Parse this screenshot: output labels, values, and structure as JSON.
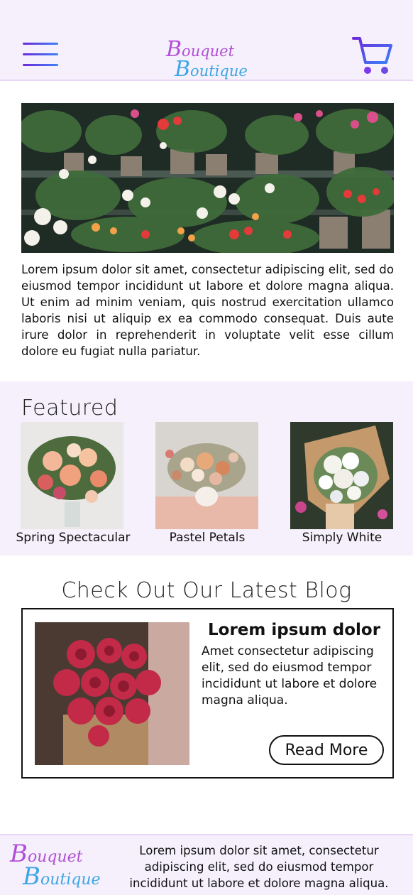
{
  "header": {
    "logo_line1_cap": "B",
    "logo_line1_rest": "ouquet",
    "logo_line2_cap": "B",
    "logo_line2_rest": "outique",
    "menu_icon": "hamburger-menu-icon",
    "cart_icon": "shopping-cart-icon"
  },
  "hero": {
    "image": "flower-shop-image",
    "text": "Lorem ipsum dolor sit amet, consectetur adipiscing elit, sed do eiusmod tempor incididunt ut labore et dolore magna aliqua. Ut enim ad minim veniam, quis nostrud exercitation ullamco laboris nisi ut aliquip ex ea commodo consequat. Duis aute irure dolor in reprehenderit in voluptate velit esse cillum dolore eu fugiat nulla pariatur."
  },
  "featured": {
    "title": "Featured",
    "items": [
      {
        "label": "Spring Spectacular"
      },
      {
        "label": "Pastel Petals"
      },
      {
        "label": "Simply White"
      }
    ]
  },
  "blog": {
    "section_title": "Check Out Our Latest Blog",
    "heading": "Lorem ipsum dolor",
    "body": "Amet consectetur adipiscing elit, sed do eiusmod tempor incididunt ut labore et dolore magna aliqua.",
    "button_label": "Read More"
  },
  "footer": {
    "logo_line1_cap": "B",
    "logo_line1_rest": "ouquet",
    "logo_line2_cap": "B",
    "logo_line2_rest": "outique",
    "text": "Lorem ipsum dolor sit amet, consectetur adipiscing elit, sed do eiusmod tempor incididunt ut labore et dolore magna aliqua."
  },
  "colors": {
    "accent_purple": "#b14fd6",
    "accent_blue": "#3ea5e6",
    "background_tint": "#f5f0fb"
  }
}
